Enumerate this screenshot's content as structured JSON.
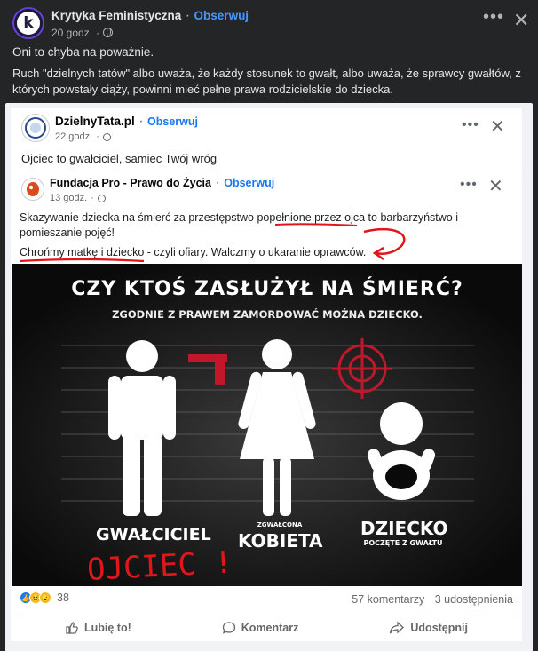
{
  "outer_post": {
    "page_name": "Krytyka Feministyczna",
    "follow_label": "Obserwuj",
    "time": "20 godz.",
    "text_line1": "Oni to chyba na poważnie.",
    "text_line2": "Ruch \"dzielnych tatów\" albo uważa, że każdy stosunek to gwałt, albo uważa, że sprawcy gwałtów, z których powstały ciąży, powinni mieć pełne prawa rodzicielskie do dziecka."
  },
  "shared_post": {
    "page_name": "DzielnyTata.pl",
    "follow_label": "Obserwuj",
    "time": "22 godz.",
    "text": "Ojciec to gwałciciel, samiec Twój wróg"
  },
  "nested_post": {
    "page_name": "Fundacja Pro - Prawo do Życia",
    "follow_label": "Obserwuj",
    "time": "13 godz.",
    "text_line1": "Skazywanie dziecka na śmierć za przestępstwo popełnione przez ojca to barbarzyństwo i",
    "text_line2": "pomieszanie pojęć!",
    "text_line3_a": "Chrońmy matkę i dziecko",
    "text_line3_b": " - czyli ofiary. Walczmy o ukaranie oprawców."
  },
  "poster": {
    "title": "CZY KTOŚ ZASŁUŻYŁ NA ŚMIERĆ?",
    "subtitle": "ZGODNIE Z PRAWEM ZAMORDOWAĆ MOŻNA DZIECKO.",
    "label_man": "GWAŁCICIEL",
    "label_woman_small": "ZGWAŁCONA",
    "label_woman": "KOBIETA",
    "label_child": "DZIECKO",
    "label_child_small": "POCZĘTE Z GWAŁTU",
    "handwritten": "OJCIEC !"
  },
  "footer": {
    "reactions_count": "38",
    "comments": "57 komentarzy",
    "shares": "3 udostępnienia",
    "like_label": "Lubię to!",
    "comment_label": "Komentarz",
    "share_label": "Udostępnij"
  },
  "colors": {
    "dark_bg": "#242526",
    "link_blue": "#4599ff",
    "fb_blue": "#1877f2",
    "annotation_red": "#e0161b"
  }
}
